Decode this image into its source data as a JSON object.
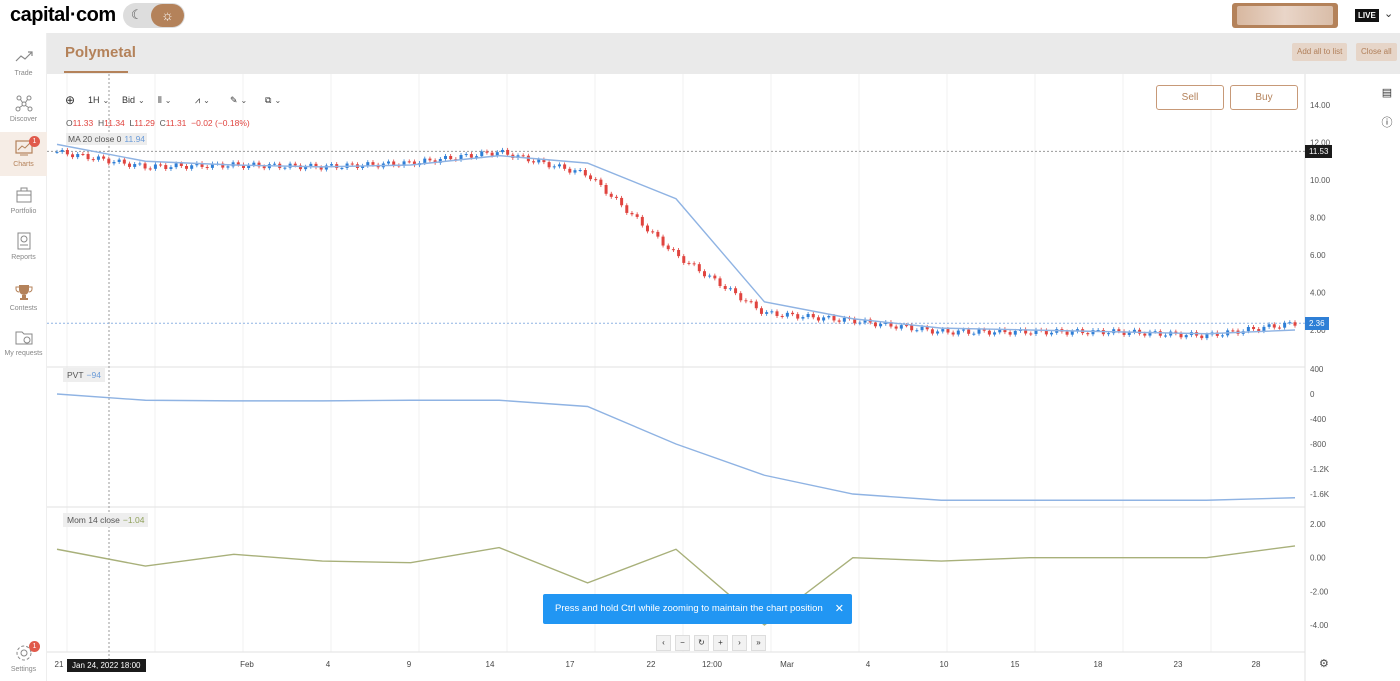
{
  "topbar": {
    "logo": "capital·com",
    "live_label": "LIVE"
  },
  "sidebar": {
    "items": [
      {
        "label": "Trade",
        "icon": "trend-icon"
      },
      {
        "label": "Discover",
        "icon": "network-icon"
      },
      {
        "label": "Charts",
        "icon": "chart-icon",
        "badge": "1"
      },
      {
        "label": "Portfolio",
        "icon": "briefcase-icon"
      },
      {
        "label": "Reports",
        "icon": "report-icon"
      },
      {
        "label": "Contests",
        "icon": "trophy-icon"
      },
      {
        "label": "My requests",
        "icon": "folder-icon"
      }
    ],
    "settings": {
      "label": "Settings",
      "badge": "1"
    }
  },
  "header": {
    "title": "Polymetal",
    "add_all": "Add all to list",
    "close_all": "Close all"
  },
  "toolbar": {
    "interval": "1H",
    "price_type": "Bid"
  },
  "trade": {
    "sell": "Sell",
    "buy": "Buy"
  },
  "ohlc": {
    "o_label": "O",
    "o": "11.33",
    "h_label": "H",
    "h": "11.34",
    "l_label": "L",
    "l": "11.29",
    "c_label": "C",
    "c": "11.31",
    "change": "−0.02 (−0.18%)"
  },
  "legends": {
    "ma": "MA 20 close 0",
    "ma_value": "11.94",
    "pvt": "PVT",
    "pvt_value": "−94",
    "mom": "Mom 14 close",
    "mom_value": "−1.04"
  },
  "price_axis": [
    "14.00",
    "12.00",
    "10.00",
    "8.00",
    "6.00",
    "4.00",
    "2.00"
  ],
  "pvt_axis": [
    "400",
    "0",
    "-400",
    "-800",
    "-1.2K",
    "-1.6K"
  ],
  "mom_axis": [
    "2.00",
    "0.00",
    "-2.00",
    "-4.00"
  ],
  "price_labels": {
    "cursor": "11.53",
    "last": "2.36"
  },
  "time_axis": [
    "21",
    "Feb",
    "4",
    "9",
    "14",
    "17",
    "22",
    "12:00",
    "Mar",
    "4",
    "10",
    "15",
    "18",
    "23",
    "28"
  ],
  "crosshair_date": "Jan 24, 2022   18:00",
  "toast": "Press and hold Ctrl while zooming to maintain the chart position",
  "colors": {
    "brand": "#b4825a",
    "up": "#2f7fd6",
    "down": "#e0443f",
    "ma": "#8fb3e3",
    "mom": "#a8b07a",
    "toast": "#2196f3"
  },
  "chart_data": {
    "type": "line",
    "x": [
      "21",
      "Feb",
      "4",
      "9",
      "14",
      "17",
      "22",
      "12:00",
      "Mar",
      "4",
      "10",
      "15",
      "18",
      "23",
      "28"
    ],
    "series": [
      {
        "name": "Polymetal",
        "values": [
          11.5,
          10.7,
          10.8,
          10.7,
          10.9,
          11.5,
          10.3,
          6.0,
          2.9,
          2.5,
          1.9,
          1.9,
          1.9,
          1.7,
          2.36
        ]
      },
      {
        "name": "MA 20 close 0",
        "values": [
          11.9,
          11.0,
          10.8,
          10.7,
          10.8,
          11.3,
          10.9,
          9.0,
          3.5,
          2.6,
          2.1,
          2.0,
          1.9,
          1.8,
          2.0
        ]
      }
    ],
    "ylim": [
      0,
      14
    ],
    "pvt": {
      "values": [
        0,
        -100,
        -110,
        -110,
        -100,
        -100,
        -200,
        -800,
        -1300,
        -1600,
        -1700,
        -1700,
        -1700,
        -1700,
        -1660
      ]
    },
    "mom": {
      "values": [
        0.5,
        -0.5,
        0.2,
        -0.2,
        -0.3,
        0.6,
        -1.5,
        0.5,
        -4.0,
        0.0,
        -0.2,
        0.0,
        0.0,
        0.0,
        0.7
      ]
    }
  }
}
